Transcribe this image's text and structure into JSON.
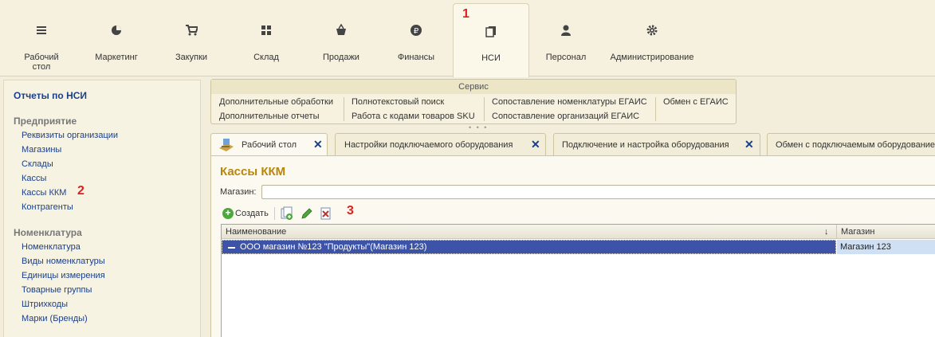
{
  "sections": [
    {
      "label": "Рабочий\nстол",
      "icon": "menu-lines-icon"
    },
    {
      "label": "Маркетинг",
      "icon": "pie-chart-icon"
    },
    {
      "label": "Закупки",
      "icon": "cart-icon"
    },
    {
      "label": "Склад",
      "icon": "grid-icon"
    },
    {
      "label": "Продажи",
      "icon": "basket-icon"
    },
    {
      "label": "Финансы",
      "icon": "ruble-icon"
    },
    {
      "label": "НСИ",
      "icon": "documents-icon"
    },
    {
      "label": "Персонал",
      "icon": "person-icon"
    },
    {
      "label": "Администрирование",
      "icon": "gear-icon"
    }
  ],
  "markers": {
    "m1": "1",
    "m2": "2",
    "m3": "3"
  },
  "left": {
    "title": "Отчеты по НСИ",
    "groups": [
      {
        "label": "Предприятие",
        "items": [
          "Реквизиты организации",
          "Магазины",
          "Склады",
          "Кассы",
          "Кассы ККМ",
          "Контрагенты"
        ]
      },
      {
        "label": "Номенклатура",
        "items": [
          "Номенклатура",
          "Виды номенклатуры",
          "Единицы измерения",
          "Товарные группы",
          "Штрихкоды",
          "Марки (Бренды)"
        ]
      }
    ]
  },
  "service": {
    "header": "Сервис",
    "items": [
      "Дополнительные обработки",
      "Дополнительные отчеты",
      "Полнотекстовый поиск",
      "Работа с кодами товаров SKU",
      "Сопоставление номенклатуры ЕГАИС",
      "Сопоставление организаций ЕГАИС",
      "Обмен с ЕГАИС"
    ],
    "dots": "• • •"
  },
  "tabs": [
    {
      "label": "Рабочий стол"
    },
    {
      "label": "Настройки подключаемого оборудования"
    },
    {
      "label": "Подключение и настройка оборудования"
    },
    {
      "label": "Обмен с подключаемым оборудование"
    }
  ],
  "close_glyph": "✕",
  "main": {
    "title": "Кассы ККМ",
    "store_label": "Магазин:",
    "store_value": "",
    "create_label": "Создать",
    "create_glyph": "+",
    "columns": [
      "Наименование",
      "Магазин"
    ],
    "sort_glyph": "↓",
    "rows": [
      {
        "name": "ООО магазин №123 \"Продукты\"(Магазин 123)",
        "store": "Магазин 123"
      }
    ]
  },
  "colors": {
    "accent_title": "#b8860b",
    "link": "#1a3f8a",
    "selection": "#3c53a8",
    "marker": "#e02020"
  }
}
